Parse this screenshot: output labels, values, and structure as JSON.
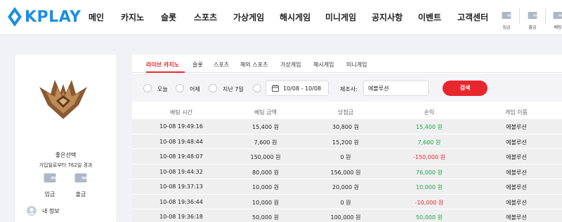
{
  "app": {
    "logo_text": "KPLAY",
    "brand_color": "#1a8fe0",
    "accent_color": "#e8262e"
  },
  "nav": {
    "items": [
      "메인",
      "카지노",
      "슬롯",
      "스포츠",
      "가상게임",
      "해시게임",
      "미니게임",
      "공지사항",
      "이벤트",
      "고객센터"
    ]
  },
  "header_buttons": [
    {
      "label": "입금",
      "icon": "wallet-icon"
    },
    {
      "label": "출금",
      "icon": "wallet-icon"
    },
    {
      "label": "베팅",
      "icon": "wallet-icon"
    }
  ],
  "sidebar": {
    "user_name": "좋은선택",
    "since": "가입일로부터 762일 경과",
    "deposit_label": "입금",
    "withdraw_label": "출금",
    "my_info_label": "내 정보"
  },
  "tabs": [
    "라이브 카지노",
    "슬롯",
    "스포츠",
    "해외 스포츠",
    "가상게임",
    "해시게임",
    "미니게임"
  ],
  "active_tab": 0,
  "filter": {
    "periods": [
      "오늘",
      "어제",
      "지난 7일"
    ],
    "date_range": "10/08 - 10/08",
    "manufacturer_label": "제조사:",
    "manufacturer_value": "에볼루션",
    "search_label": "검색"
  },
  "table": {
    "columns": [
      "베팅 시간",
      "베팅 금액",
      "당첨금",
      "손익",
      "게임 이름"
    ],
    "rows": [
      {
        "time": "10-08 19:49:16",
        "bet": "15,400 원",
        "win": "30,800 원",
        "profit": "15,400 원",
        "sign": "pos",
        "game": "에볼루션"
      },
      {
        "time": "10-08 19:48:44",
        "bet": "7,600 원",
        "win": "15,200 원",
        "profit": "7,600 원",
        "sign": "pos",
        "game": "에볼루션"
      },
      {
        "time": "10-08 19:48:07",
        "bet": "150,000 원",
        "win": "0 원",
        "profit": "-150,000 원",
        "sign": "neg",
        "game": "에볼루션"
      },
      {
        "time": "10-08 19:44:32",
        "bet": "80,000 원",
        "win": "156,000 원",
        "profit": "76,000 원",
        "sign": "pos",
        "game": "에볼루션"
      },
      {
        "time": "10-08 19:37:13",
        "bet": "10,000 원",
        "win": "20,000 원",
        "profit": "10,000 원",
        "sign": "pos",
        "game": "에볼루션"
      },
      {
        "time": "10-08 19:36:44",
        "bet": "10,000 원",
        "win": "0 원",
        "profit": "-10,000 원",
        "sign": "neg",
        "game": "에볼루션"
      },
      {
        "time": "10-08 19:36:18",
        "bet": "50,000 원",
        "win": "100,000 원",
        "profit": "50,000 원",
        "sign": "pos",
        "game": "에볼루션"
      }
    ]
  }
}
